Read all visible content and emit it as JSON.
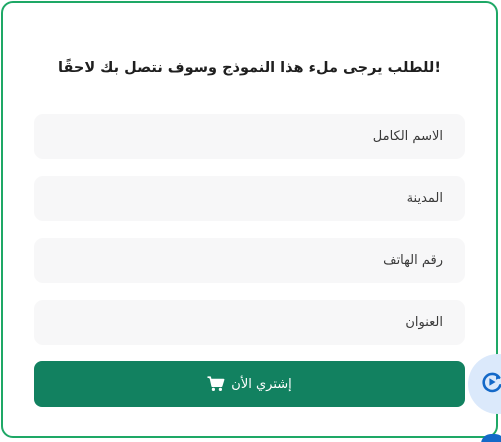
{
  "form": {
    "heading": "!للطلب يرجى ملء هذا النموذج وسوف نتصل بك لاحقًا",
    "fields": {
      "full_name_placeholder": "الاسم الكامل",
      "city_placeholder": "المدينة",
      "phone_placeholder": "رقم الهاتف",
      "address_placeholder": "العنوان"
    },
    "submit_label": "إشتري الأن",
    "submit_icon": "cart-icon"
  },
  "widget": {
    "icon": "play-refresh-icon"
  },
  "colors": {
    "border": "#1ea866",
    "button": "#128160",
    "field_bg": "#f7f7f8",
    "widget_bg": "#dbe9fb",
    "widget_icon": "#1469c8"
  }
}
